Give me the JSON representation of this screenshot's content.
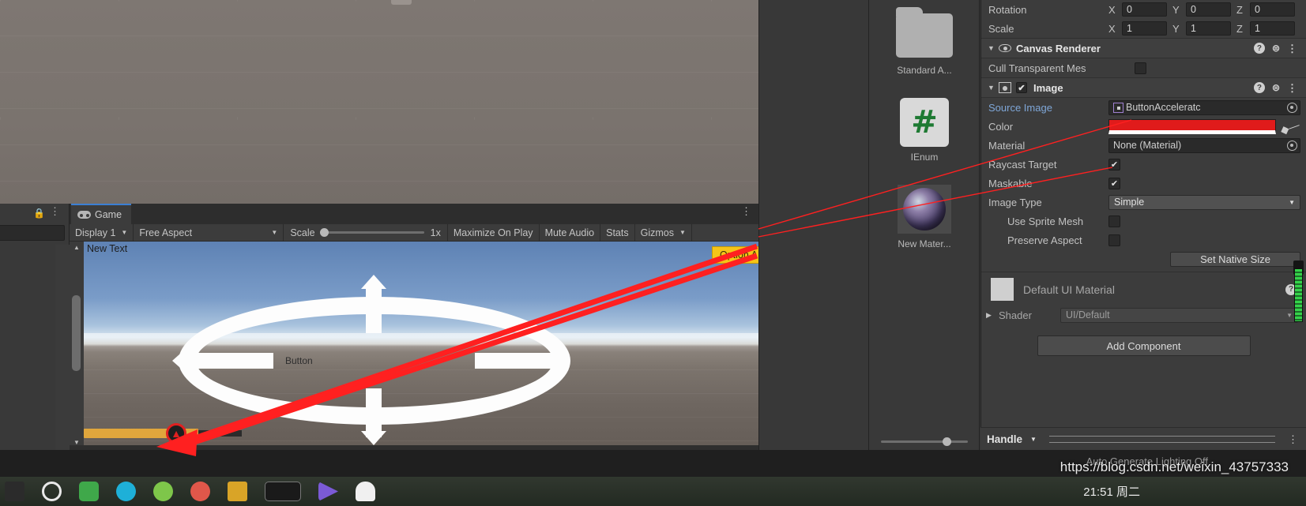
{
  "scene": {
    "name": "scene-view"
  },
  "game_panel": {
    "tab_label": "Game",
    "toolbar": {
      "display": "Display 1",
      "aspect": "Free Aspect",
      "scale_label": "Scale",
      "scale_value": "1x",
      "maximize_on_play": "Maximize On Play",
      "mute_audio": "Mute Audio",
      "stats": "Stats",
      "gizmos": "Gizmos"
    },
    "render": {
      "new_text": "New Text",
      "button_label": "Button",
      "dropdown_value": "Option A"
    }
  },
  "project": {
    "assets": [
      {
        "name": "Standard A...",
        "icon": "folder-icon"
      },
      {
        "name": "IEnum",
        "icon": "csharp-script-icon"
      },
      {
        "name": "New Mater...",
        "icon": "material-sphere-icon"
      }
    ]
  },
  "inspector": {
    "transform": {
      "rotation_label": "Rotation",
      "rotation": {
        "x": "0",
        "y": "0",
        "z": "0"
      },
      "scale_label": "Scale",
      "scale": {
        "x": "1",
        "y": "1",
        "z": "1"
      },
      "axis_x": "X",
      "axis_y": "Y",
      "axis_z": "Z"
    },
    "canvas_renderer": {
      "title": "Canvas Renderer",
      "cull_transparent_label": "Cull Transparent Mes",
      "cull_transparent_value": ""
    },
    "image": {
      "title": "Image",
      "enabled_mark": "✔",
      "source_image_label": "Source Image",
      "source_image_value": "ButtonAcceleratc",
      "color_label": "Color",
      "color_value": "#E01B1B",
      "material_label": "Material",
      "material_value": "None (Material)",
      "raycast_target_label": "Raycast Target",
      "raycast_target_value": "✔",
      "maskable_label": "Maskable",
      "maskable_value": "✔",
      "image_type_label": "Image Type",
      "image_type_value": "Simple",
      "use_sprite_mesh_label": "Use Sprite Mesh",
      "preserve_aspect_label": "Preserve Aspect",
      "set_native_size_label": "Set Native Size"
    },
    "material_section": {
      "name": "Default UI Material",
      "shader_label": "Shader",
      "shader_value": "UI/Default"
    },
    "add_component_label": "Add Component",
    "help_glyph": "?"
  },
  "handle_bar": {
    "label": "Handle"
  },
  "status_bar": {
    "message": "Auto Generate Lighting Off",
    "watermark": "https://blog.csdn.net/weixin_43757333"
  },
  "taskbar": {
    "clock": "21:51 周二"
  }
}
